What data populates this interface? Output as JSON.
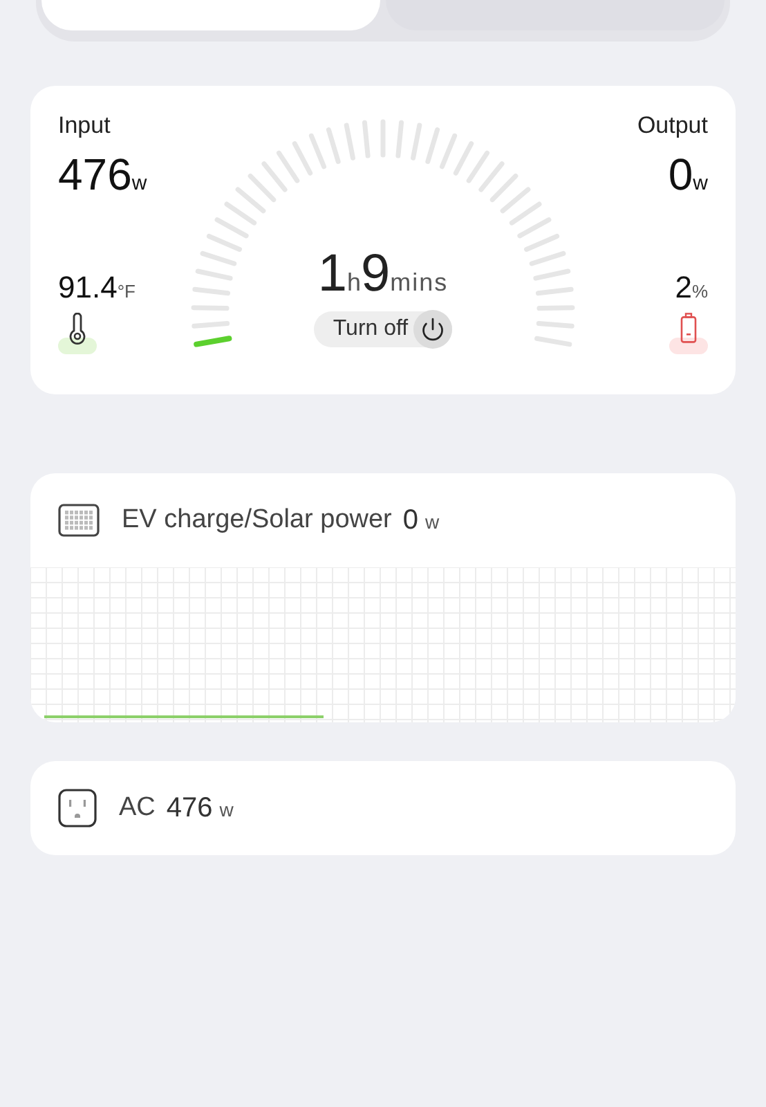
{
  "tabs": [
    {
      "selected": true
    },
    {
      "selected": false
    }
  ],
  "summary": {
    "input": {
      "label": "Input",
      "value": "476",
      "unit": "w"
    },
    "output": {
      "label": "Output",
      "value": "0",
      "unit": "w"
    },
    "temperature": {
      "value": "91.4",
      "unit": "°F"
    },
    "battery": {
      "value": "2",
      "unit": "%"
    },
    "gauge": {
      "level": 0.02
    },
    "remaining": {
      "hours": "1",
      "hours_unit": "h",
      "minutes": "9",
      "minutes_unit": "mins"
    },
    "turn_off_label": "Turn off"
  },
  "sources": [
    {
      "kind": "chart",
      "label": "EV charge/Solar power",
      "value": "0",
      "unit": "w"
    },
    {
      "kind": "plain",
      "label": "AC",
      "value": "476",
      "unit": "w"
    }
  ]
}
